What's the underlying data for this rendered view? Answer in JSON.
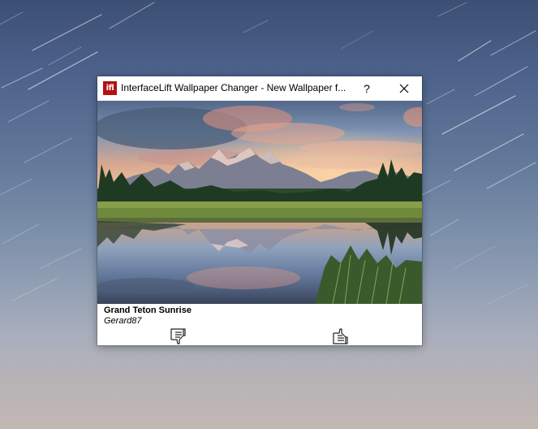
{
  "window": {
    "title": "InterfaceLift Wallpaper Changer - New Wallpaper f...",
    "app_icon_text": "ifl",
    "help_label": "?"
  },
  "wallpaper": {
    "title": "Grand Teton Sunrise",
    "author": "Gerard87"
  },
  "icons": {
    "app": "interfacelift-logo-icon",
    "help": "help-icon",
    "close": "close-icon",
    "dislike": "thumbs-down-icon",
    "like": "thumbs-up-icon"
  },
  "colors": {
    "app_icon_bg": "#b31212",
    "window_bg": "#ffffff"
  }
}
